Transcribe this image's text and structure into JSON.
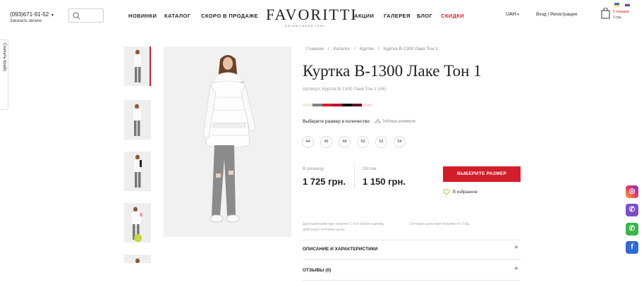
{
  "header": {
    "phone": "(093)671-91-52",
    "callback": "Заказать звонок",
    "nav_left": [
      "НОВИНКИ",
      "КАТАЛОГ",
      "СКОРО В ПРОДАЖЕ"
    ],
    "logo": "FAVORITTI",
    "logo_sub": "ESTABLISHED 1992",
    "nav_right": [
      "АКЦИИ",
      "ГАЛЕРЕЯ",
      "БЛОГ"
    ],
    "nav_sale": "СКИДКИ",
    "currency": "UAH",
    "login": "Вход / Регистрация",
    "cart_count": "0 товаров",
    "cart_sum": "0 грн."
  },
  "side_tab": "Скачать прайс",
  "breadcrumbs": [
    "Главная",
    "Каталог",
    "Куртки",
    "Куртка В-1300 Лаке Тон 1"
  ],
  "product": {
    "title": "Куртка В-1300 Лаке Тон 1",
    "sku": "Артикул: Куртка В-1300 Лаке Тон 1 (44)",
    "colors": [
      "#f3ecd6",
      "#7d8188",
      "#d21e2b",
      "#b21a26",
      "#111111",
      "#5c1422",
      "#f6dfe3"
    ],
    "choose_label": "Выберите размер и количество",
    "size_chart": "Таблица размеров",
    "sizes": [
      "44",
      "46",
      "48",
      "50",
      "52",
      "54"
    ],
    "retail_label": "В розницу",
    "retail_price": "1 725 грн.",
    "wholesale_label": "Оптом",
    "wholesale_price": "1 150 грн.",
    "buy_button": "ВЫБЕРИТЕ РАЗМЕР",
    "favorite": "В избранное",
    "note_left": "Дропшиперам при покупке 1-й и более единиц действует оптовая цена.",
    "note_right": "Оптовая цена при покупке от 3 ед.",
    "accordion": [
      "ОПИСАНИЕ И ХАРАКТЕРИСТИКИ",
      "ОТЗЫВЫ (0)"
    ]
  },
  "colors": {
    "accent": "#d21e2b",
    "thumb_more": "#c6d13a"
  }
}
